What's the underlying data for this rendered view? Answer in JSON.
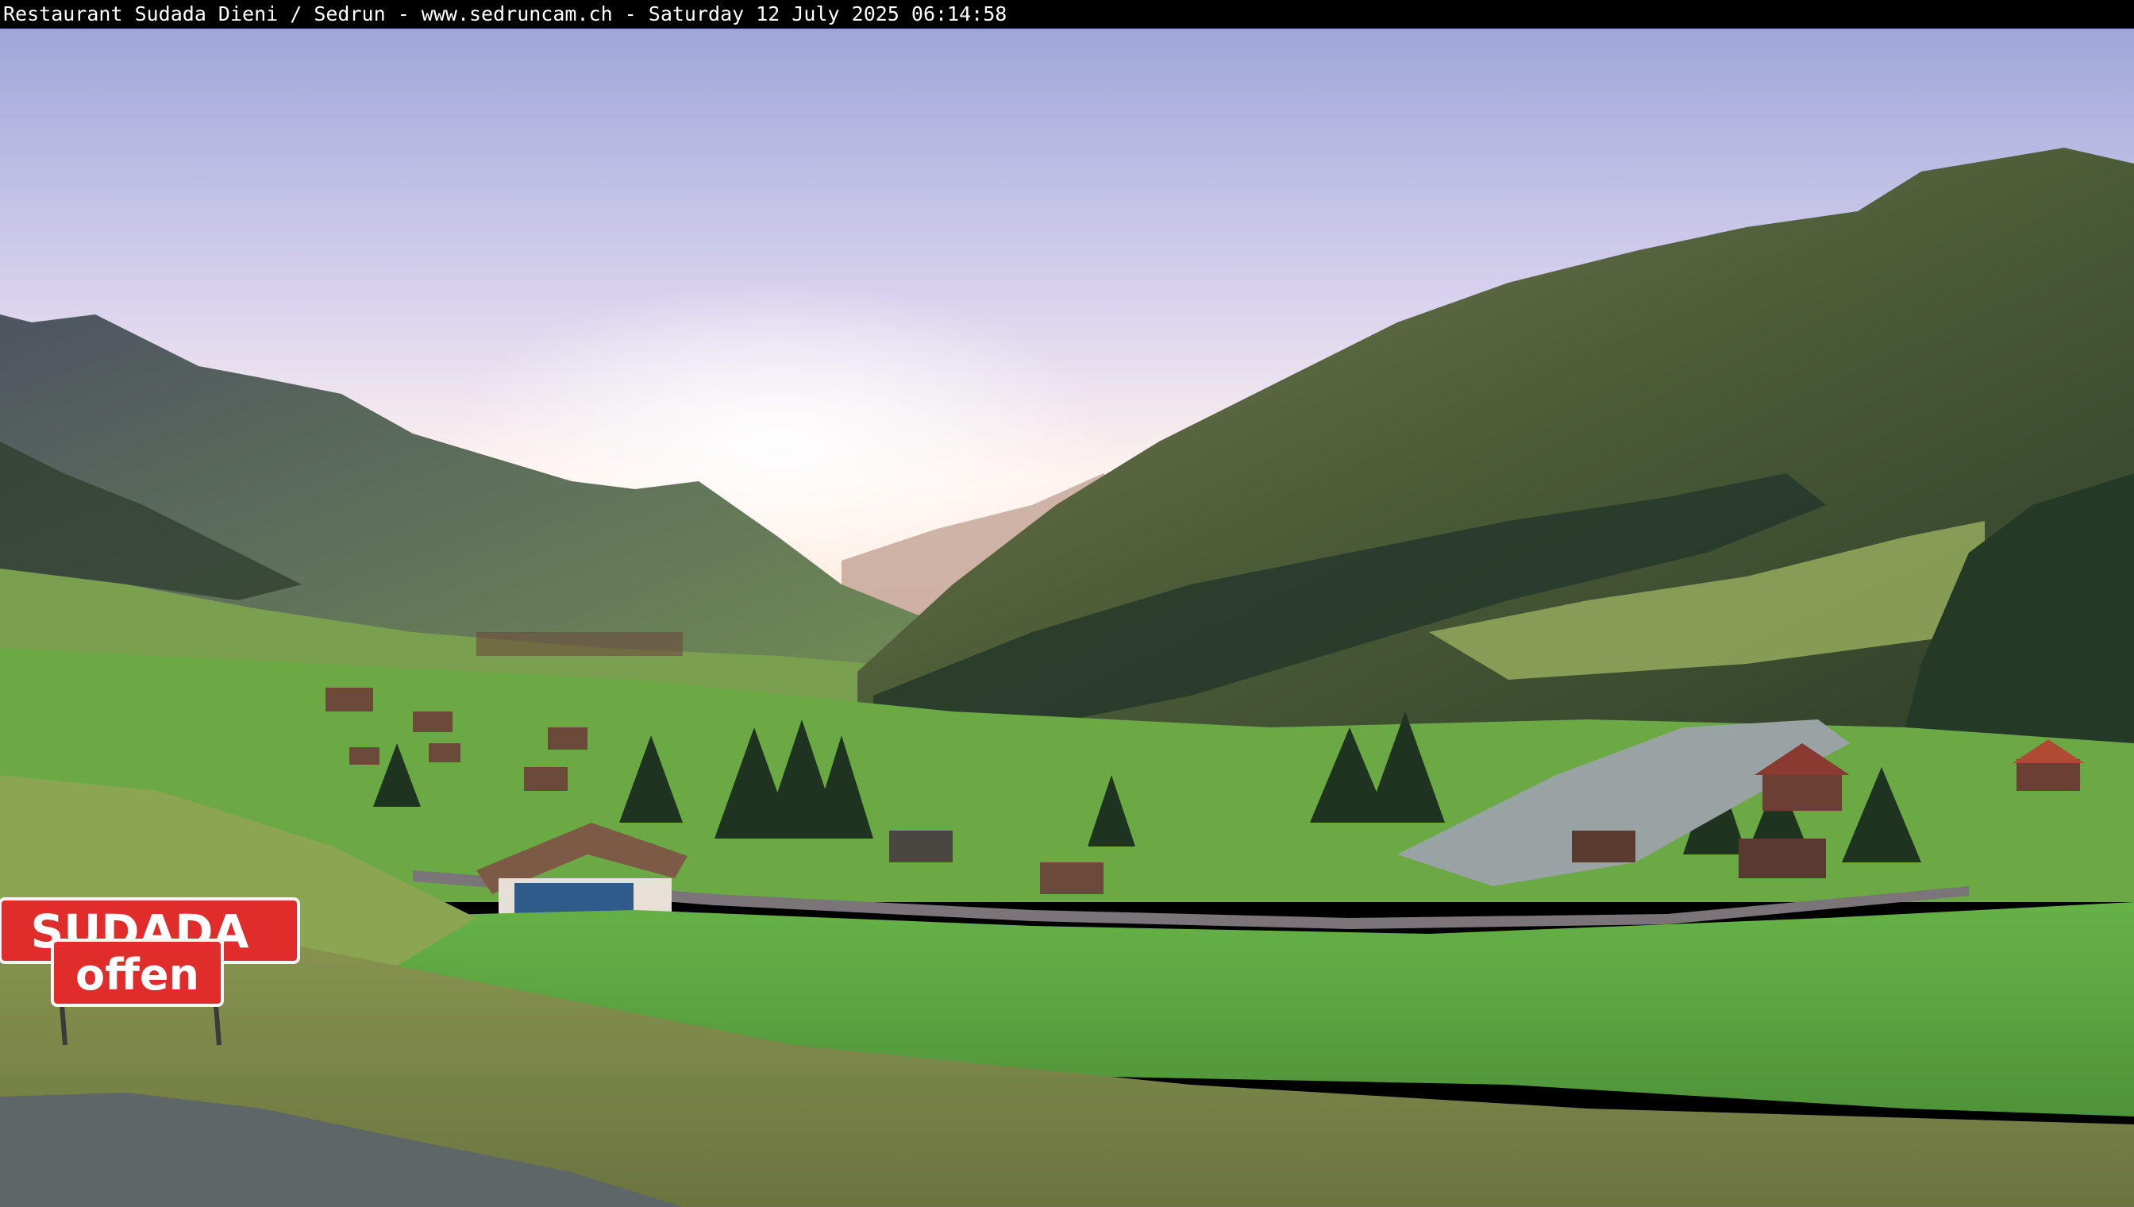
{
  "caption": {
    "text": "Restaurant Sudada Dieni / Sedrun - www.sedruncam.ch - Saturday 12 July 2025 06:14:58"
  },
  "signs": {
    "upper": "SUDADA",
    "lower": "offen"
  },
  "colors": {
    "sky_top": "#9ea6d8",
    "sky_horizon": "#fff4ee",
    "meadow": "#5fa843",
    "mountain_shadow": "#3c4f34",
    "sign_red": "#e02c2a",
    "road": "#5e6668"
  }
}
